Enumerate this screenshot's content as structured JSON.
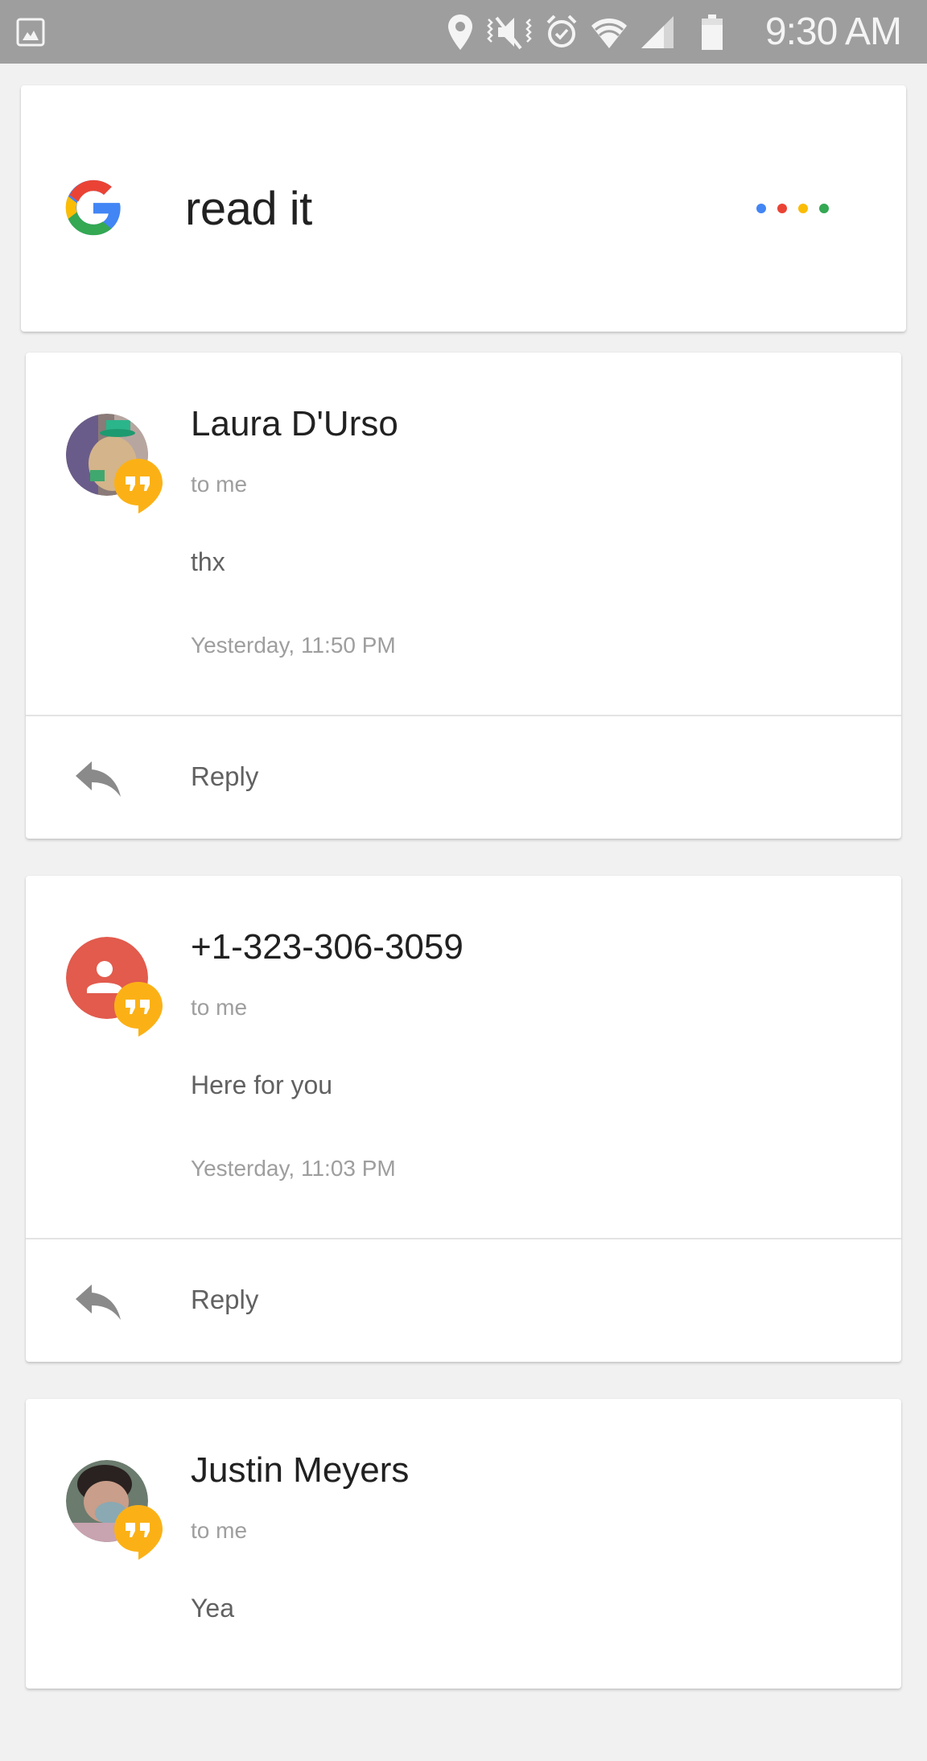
{
  "status_bar": {
    "left_icons": [
      "gallery-notification-icon"
    ],
    "right_icons": [
      "location-icon",
      "vibrate-mute-icon",
      "alarm-icon",
      "wifi-icon",
      "cell-signal-icon",
      "battery-icon"
    ],
    "time": "9:30 AM"
  },
  "query_card": {
    "logo": "google-g-logo",
    "query": "read it",
    "dot_colors": [
      "#4285f4",
      "#ea4335",
      "#fbbc05",
      "#34a853"
    ]
  },
  "messages": [
    {
      "sender": "Laura D'Urso",
      "avatar": "photo",
      "app_badge": "hangouts-icon",
      "recipient": "to me",
      "body": "thx",
      "timestamp": "Yesterday, 11:50 PM",
      "action_label": "Reply"
    },
    {
      "sender": "+1-323-306-3059",
      "avatar": "default-contact",
      "avatar_color": "#e25b4d",
      "app_badge": "hangouts-icon",
      "recipient": "to me",
      "body": "Here for you",
      "timestamp": "Yesterday, 11:03 PM",
      "action_label": "Reply"
    },
    {
      "sender": "Justin Meyers",
      "avatar": "photo",
      "app_badge": "hangouts-icon",
      "recipient": "to me",
      "body": "Yea"
    }
  ],
  "colors": {
    "hangouts": "#fbb116",
    "status_bar": "#9e9e9e",
    "background": "#f1f1f1"
  }
}
